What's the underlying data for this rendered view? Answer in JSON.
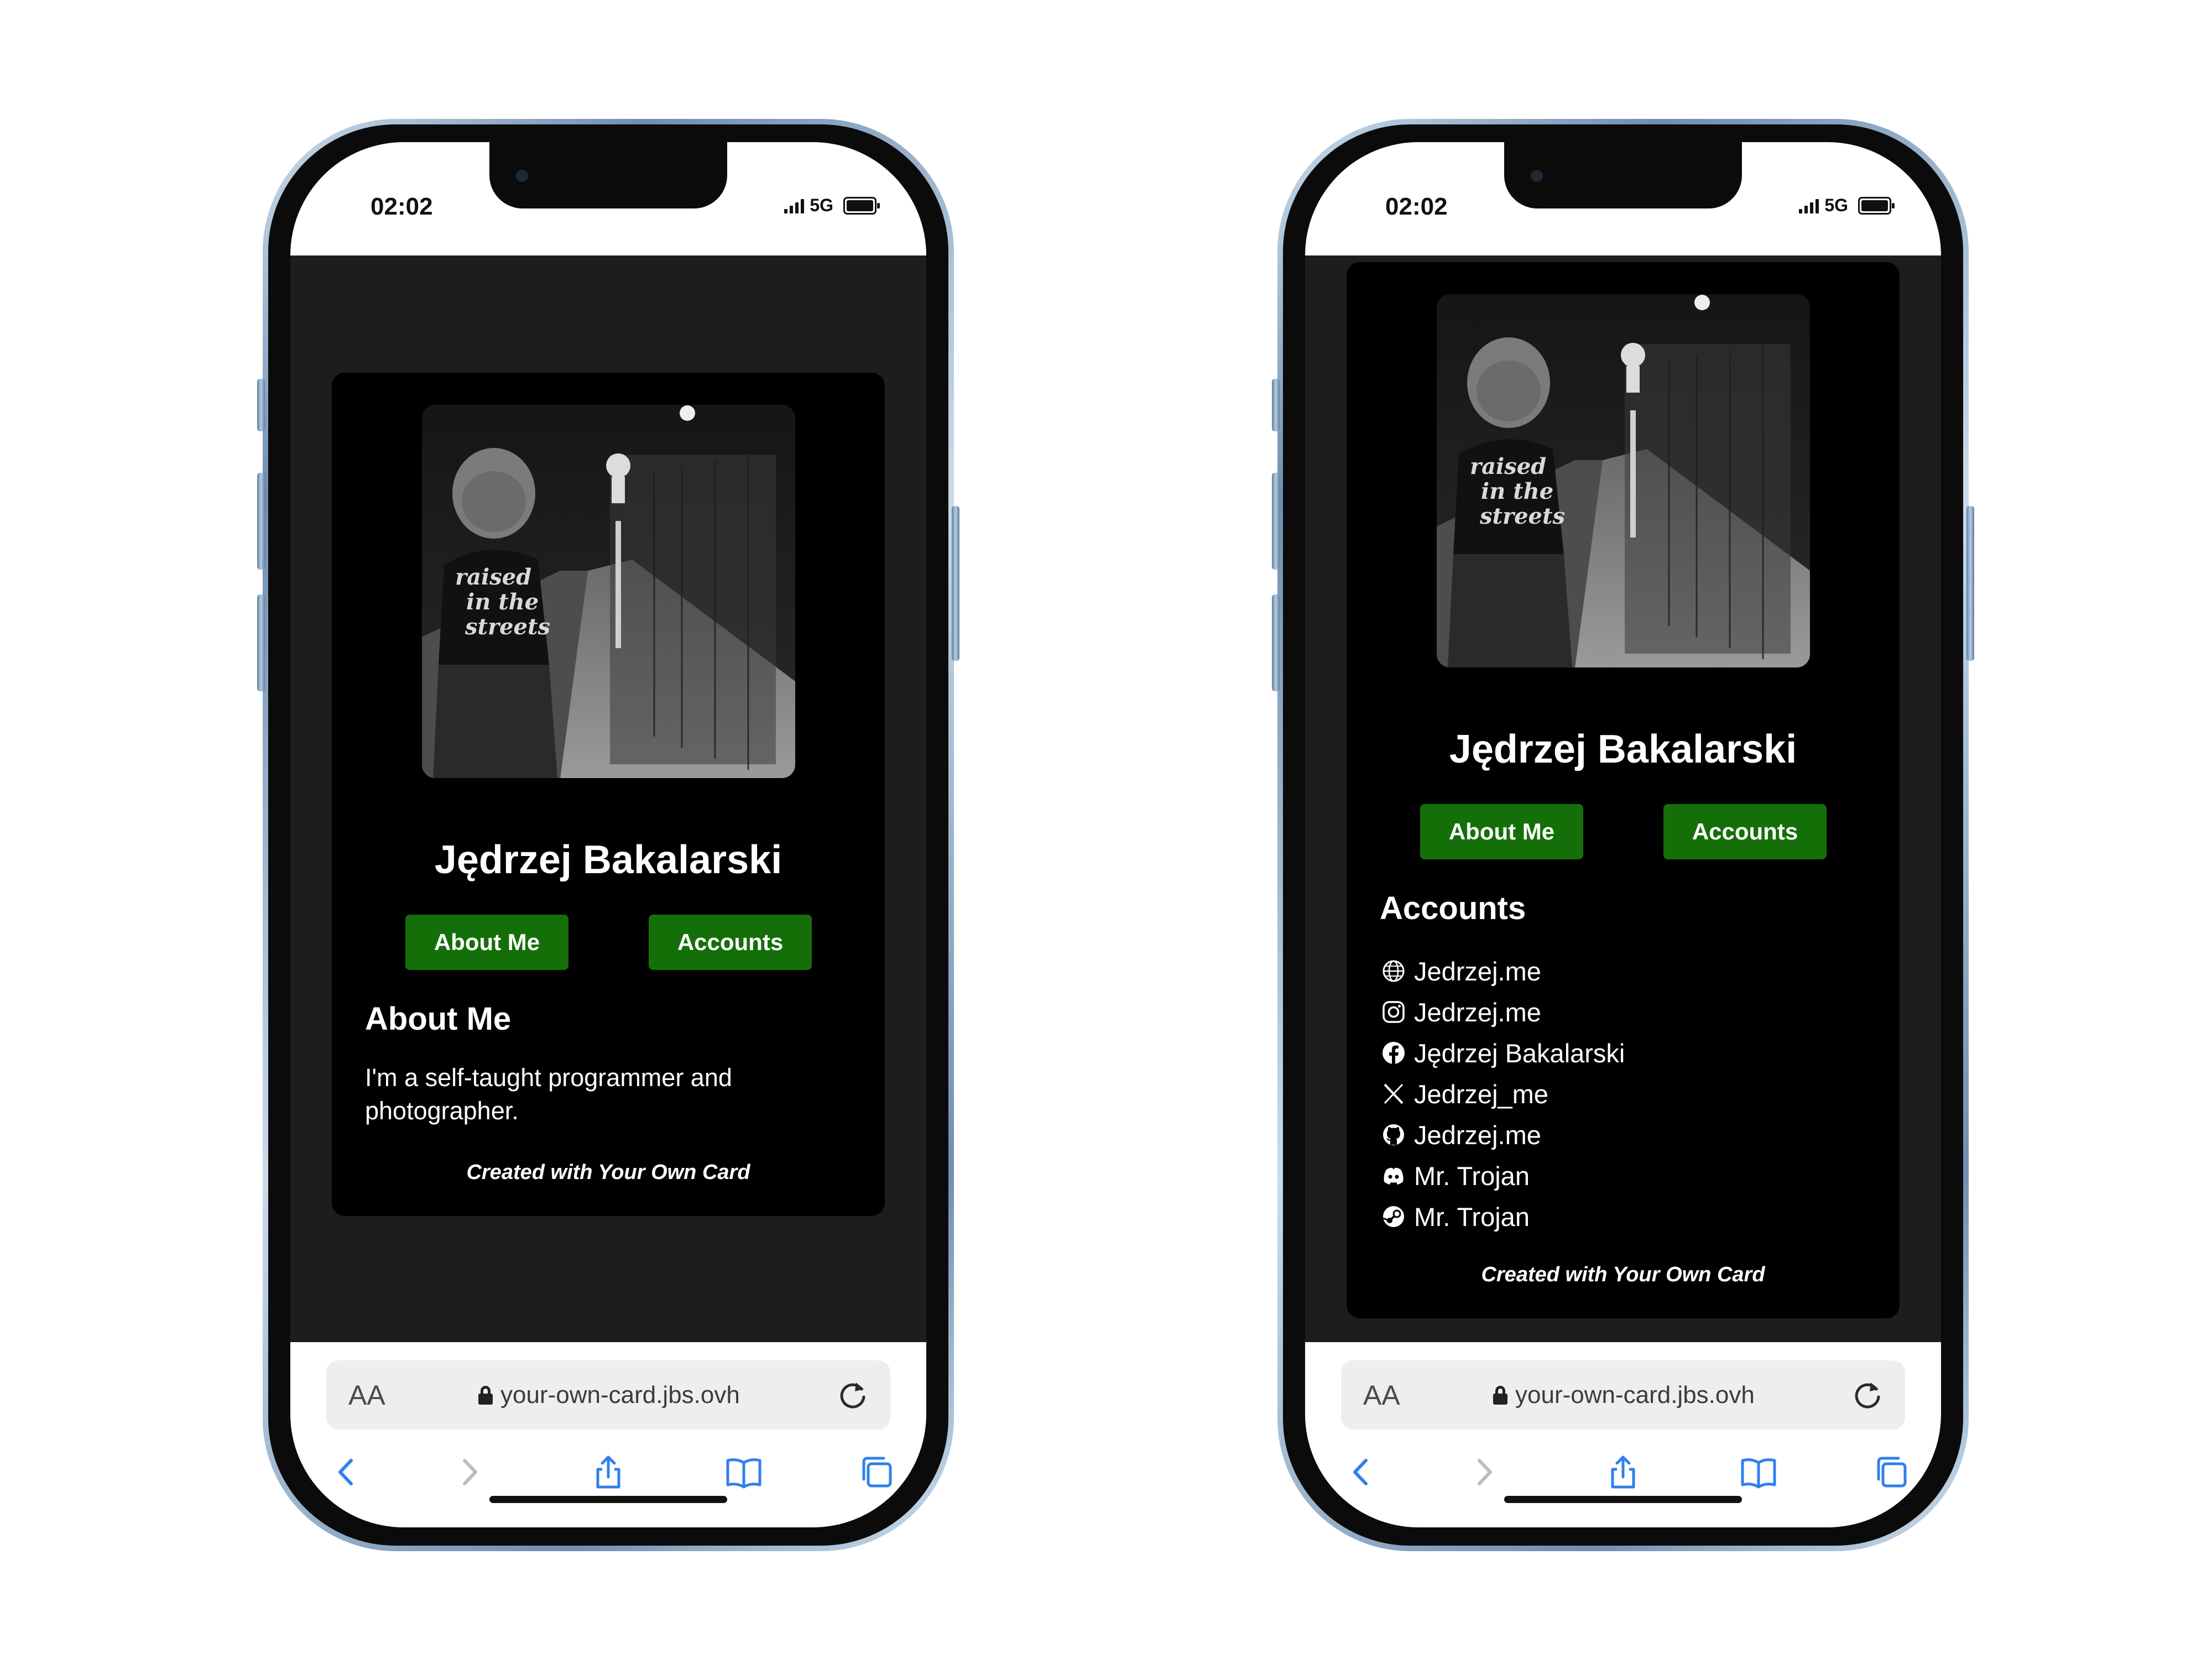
{
  "status_bar": {
    "time": "02:02",
    "network": "5G"
  },
  "profile": {
    "name": "Jędrzej Bakalarski"
  },
  "buttons": {
    "about": "About Me",
    "accounts": "Accounts"
  },
  "about_section": {
    "title": "About Me",
    "text": "I'm a self-taught programmer and photographer."
  },
  "accounts_section": {
    "title": "Accounts",
    "items": [
      {
        "icon": "website-icon",
        "label": "Jedrzej.me"
      },
      {
        "icon": "instagram-icon",
        "label": "Jedrzej.me"
      },
      {
        "icon": "facebook-icon",
        "label": "Jędrzej Bakalarski"
      },
      {
        "icon": "x-icon",
        "label": "Jedrzej_me"
      },
      {
        "icon": "github-icon",
        "label": "Jedrzej.me"
      },
      {
        "icon": "discord-icon",
        "label": "Mr. Trojan"
      },
      {
        "icon": "steam-icon",
        "label": "Mr. Trojan"
      }
    ]
  },
  "footer": "Created with Your Own Card",
  "browser": {
    "text_size": "AA",
    "url": "your-own-card.jbs.ovh"
  },
  "colors": {
    "accent_green": "#156f09",
    "card_bg": "#000000",
    "page_bg": "#1d1d1d"
  }
}
